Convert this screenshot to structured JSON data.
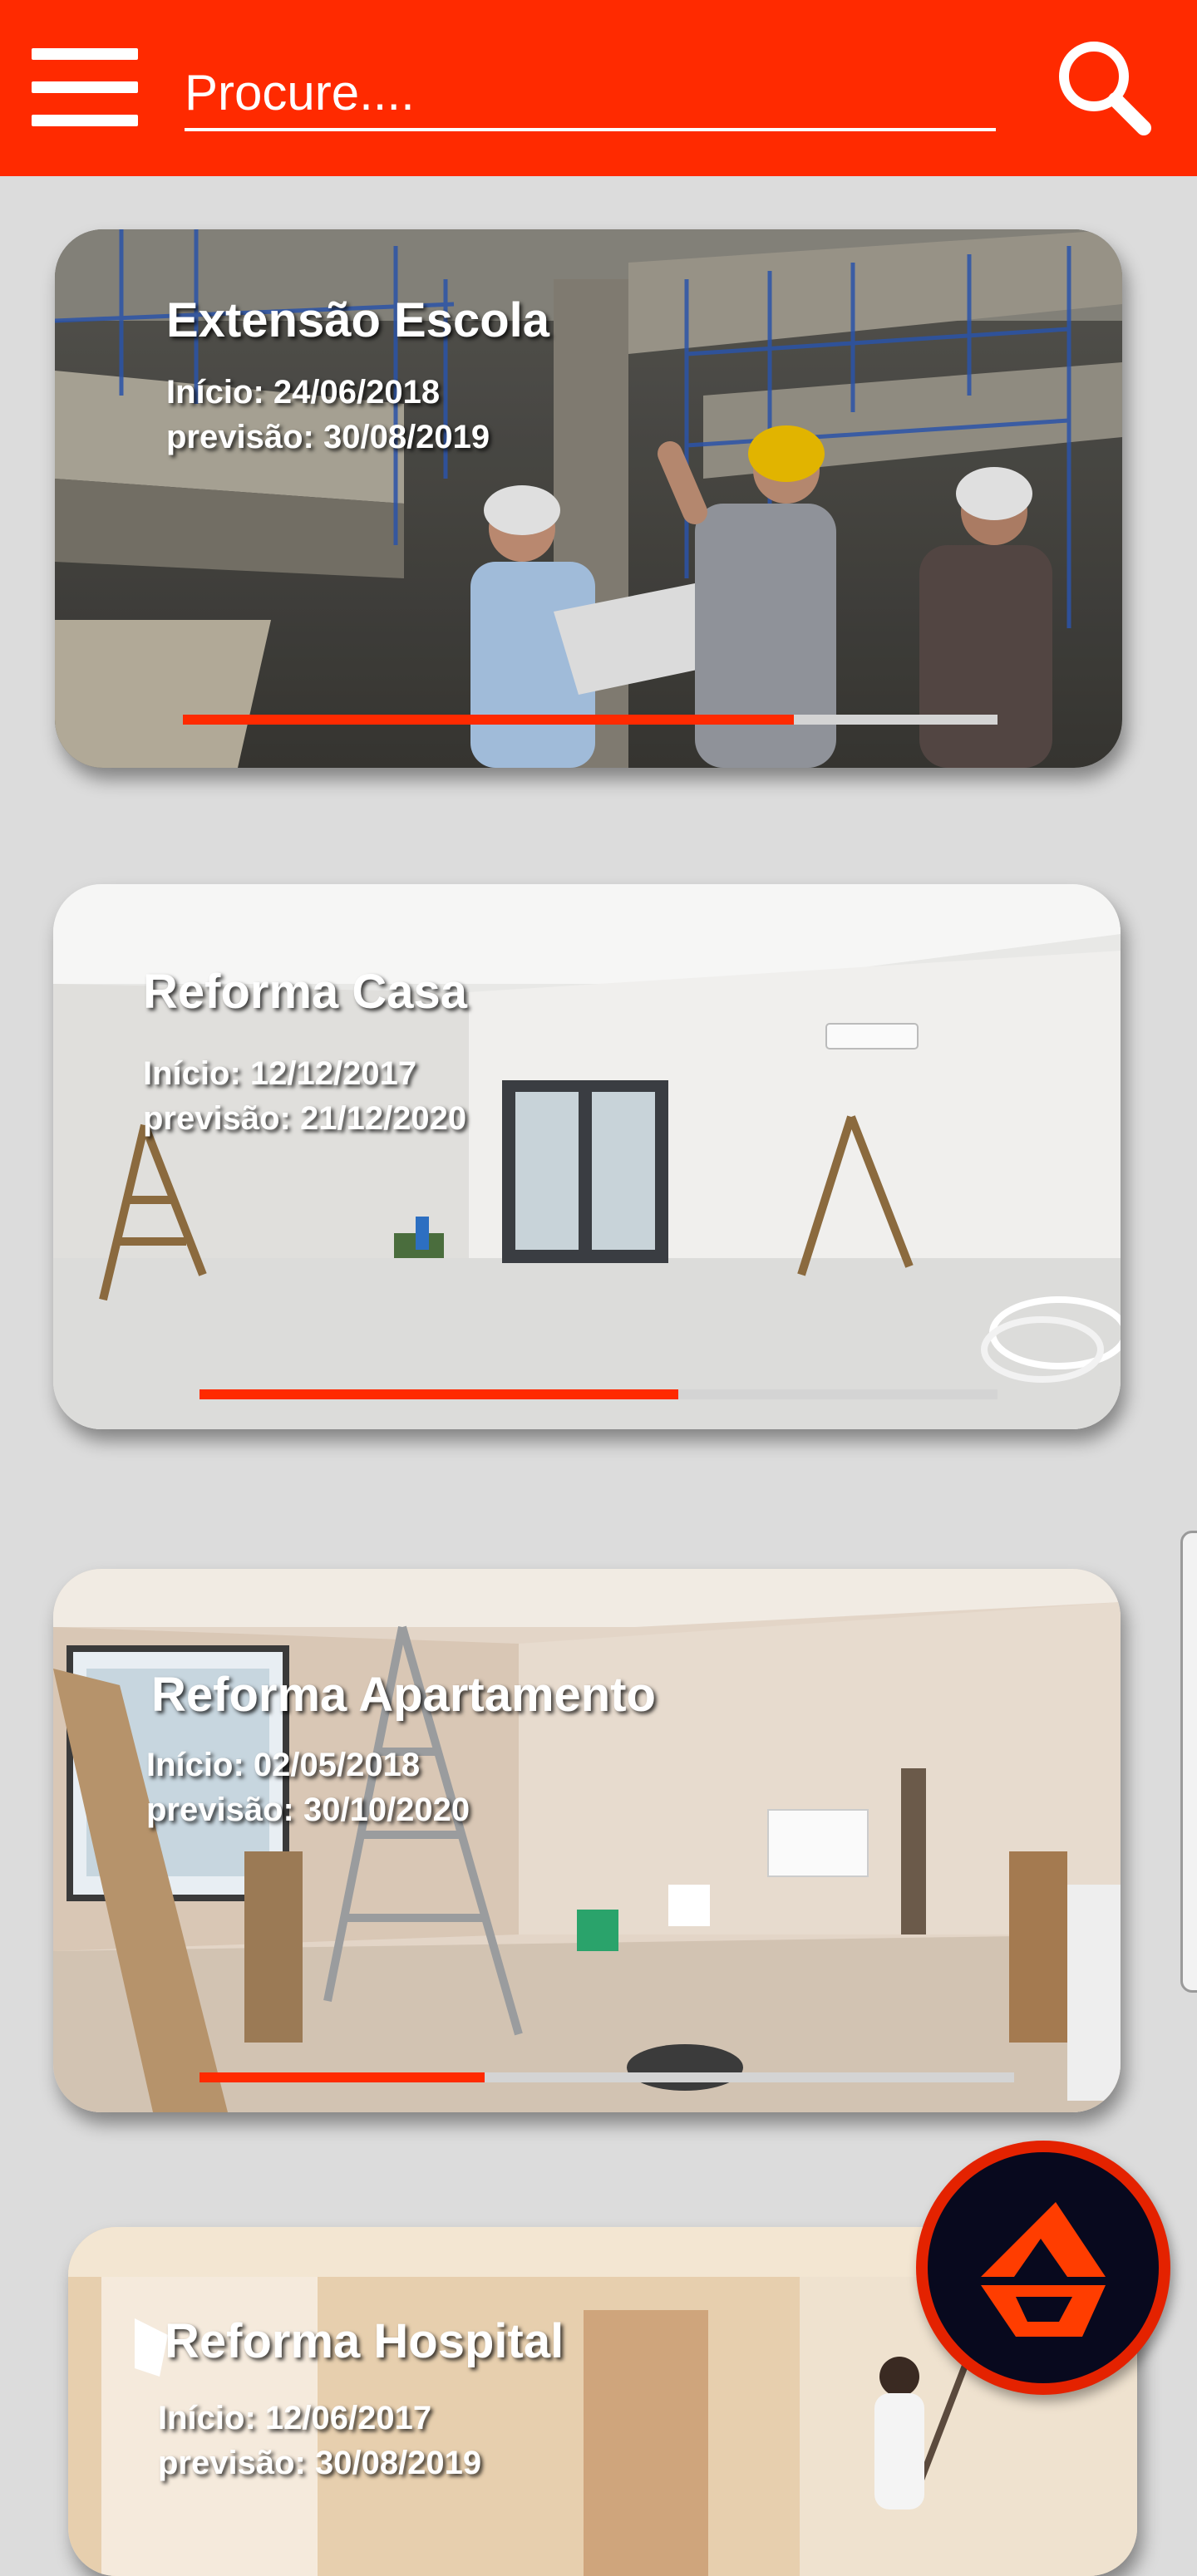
{
  "header": {
    "search_placeholder": "Procure....",
    "menu_icon": "hamburger-menu-icon",
    "search_icon": "search-icon",
    "accent_color": "#ff2a00"
  },
  "projects": [
    {
      "title": "Extensão Escola",
      "start": "Início: 24/06/2018",
      "forecast": "previsão: 30/08/2019",
      "progress": 0.75
    },
    {
      "title": "Reforma Casa",
      "start": "Início: 12/12/2017",
      "forecast": "previsão: 21/12/2020",
      "progress": 0.6
    },
    {
      "title": "Reforma Apartamento",
      "start": "Início: 02/05/2018",
      "forecast": "previsão: 30/10/2020",
      "progress": 0.35
    },
    {
      "title": "Reforma Hospital",
      "start": "Início: 12/06/2017",
      "forecast": "previsão: 30/08/2019"
    }
  ],
  "fab": {
    "icon": "app-logo-icon",
    "bg_color": "#08091e",
    "ring_color": "#e42200"
  }
}
